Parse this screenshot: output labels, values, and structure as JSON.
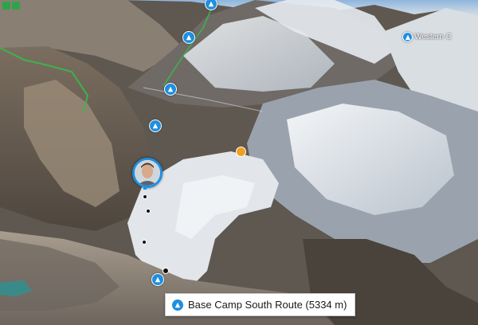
{
  "map": {
    "view": "3D satellite terrain",
    "selected_label": "Base Camp South Route (5334 m)",
    "distant_tag": "Western C"
  },
  "icons": {
    "waypoint": "mountain-waypoint-icon",
    "user": "user-avatar-pin",
    "highlight": "gold-point-icon"
  },
  "colors": {
    "waypoint": "#1f8fe0",
    "route": "#3cb44b",
    "highlight": "#f0a020"
  }
}
